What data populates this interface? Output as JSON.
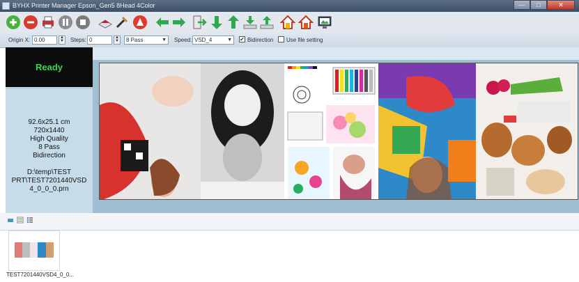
{
  "window": {
    "title": "BYHX  Printer Manager Epson_Gen5 8Head 4Color",
    "btn_min": "—",
    "btn_max": "□",
    "btn_close": "✕"
  },
  "settings": {
    "origin_x_label": "Origin X:",
    "origin_x_value": "0.00",
    "steps_label": "Steps:",
    "steps_value": "0",
    "pass_value": "8 Pass",
    "speed_label": "Speed:",
    "speed_value": "VSD_4",
    "bidirection_label": "Bidirection",
    "bidirection_checked": "✔",
    "use_file_label": "Use file setting"
  },
  "status": {
    "text": "Ready"
  },
  "job_info": {
    "size": "92.6x25.1 cm",
    "resolution": "720x1440",
    "quality": "High Quality",
    "passes": "8 Pass",
    "direction": "Bidirection",
    "path_line1": "D:\\temp\\TEST",
    "path_line2": "PRT\\TEST7201440VSD",
    "path_line3": "4_0_0_0.prn"
  },
  "job_list": {
    "thumb_name": "TEST7201440VSD4_0_0..."
  }
}
